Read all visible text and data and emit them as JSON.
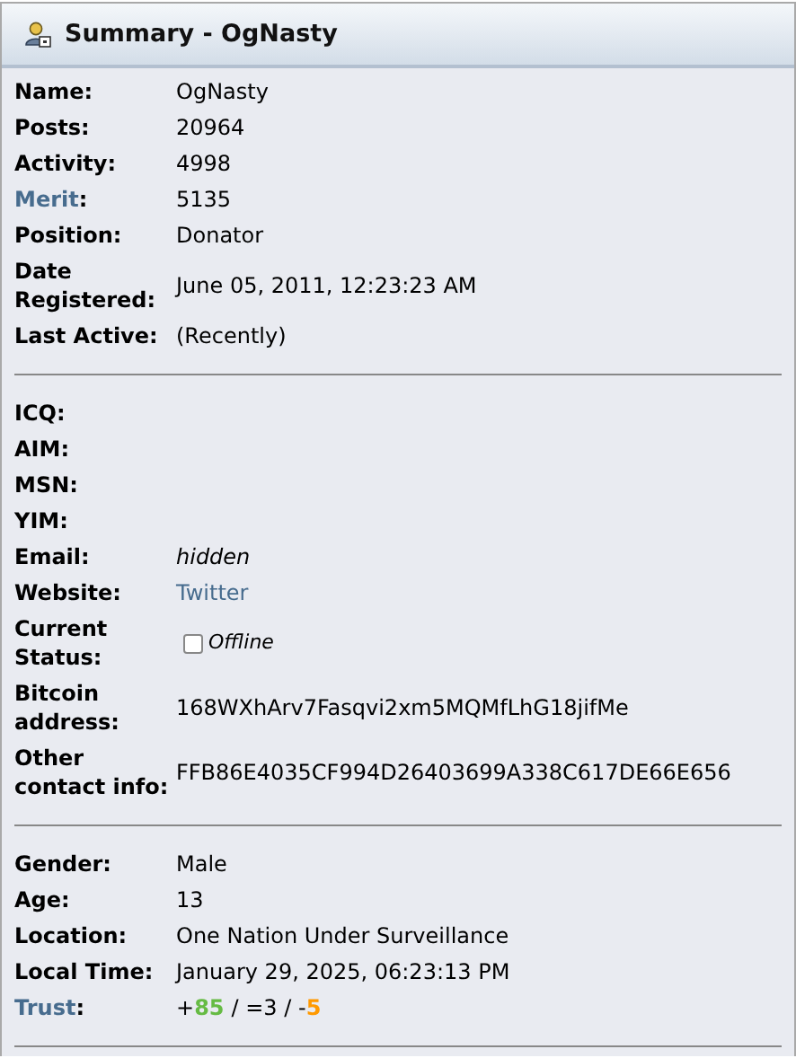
{
  "header": {
    "title": "Summary - OgNasty"
  },
  "sections": [
    {
      "rows": [
        {
          "label": "Name:",
          "kind": "text",
          "value": "OgNasty"
        },
        {
          "label": "Posts:",
          "kind": "text",
          "value": "20964"
        },
        {
          "label": "Activity:",
          "kind": "text",
          "value": "4998"
        },
        {
          "label": "Merit",
          "label_link": true,
          "suffix": ":",
          "kind": "text",
          "value": "5135"
        },
        {
          "label": "Position:",
          "kind": "text",
          "value": "Donator"
        },
        {
          "label": "Date Registered:",
          "kind": "text",
          "value": "June 05, 2011, 12:23:23 AM"
        },
        {
          "label": "Last Active:",
          "kind": "text",
          "value": "(Recently)"
        }
      ]
    },
    {
      "rows": [
        {
          "label": "ICQ:",
          "kind": "empty"
        },
        {
          "label": "AIM:",
          "kind": "empty"
        },
        {
          "label": "MSN:",
          "kind": "empty"
        },
        {
          "label": "YIM:",
          "kind": "empty"
        },
        {
          "label": "Email:",
          "kind": "italic",
          "value": "hidden"
        },
        {
          "label": "Website:",
          "kind": "link",
          "value": "Twitter"
        },
        {
          "label": "Current Status:",
          "kind": "status",
          "checked": false,
          "value": "Offline"
        },
        {
          "label": "Bitcoin address:",
          "kind": "text",
          "value": "168WXhArv7Fasqvi2xm5MQMfLhG18jifMe"
        },
        {
          "label": "Other contact info:",
          "kind": "text",
          "value": "FFB86E4035CF994D26403699A338C617DE66E656"
        }
      ]
    },
    {
      "rows": [
        {
          "label": "Gender:",
          "kind": "text",
          "value": "Male"
        },
        {
          "label": "Age:",
          "kind": "text",
          "value": "13"
        },
        {
          "label": "Location:",
          "kind": "text",
          "value": "One Nation Under Surveillance"
        },
        {
          "label": "Local Time:",
          "kind": "text",
          "value": "January 29, 2025, 06:23:13 PM"
        },
        {
          "label": "Trust",
          "label_link": true,
          "suffix": ":",
          "kind": "trust",
          "parts": [
            {
              "text": "+"
            },
            {
              "text": "85",
              "color": "#66bb44"
            },
            {
              "text": "/ =3 / -"
            },
            {
              "text": "5",
              "color": "#ff9900"
            }
          ]
        }
      ]
    }
  ]
}
